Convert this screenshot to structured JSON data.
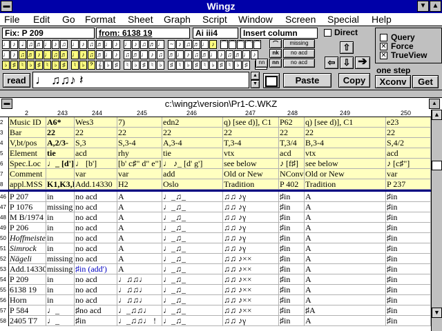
{
  "app": {
    "title": "Wingz"
  },
  "menu": [
    "File",
    "Edit",
    "Go",
    "Format",
    "Sheet",
    "Graph",
    "Script",
    "Window",
    "Screen",
    "Special",
    "Help"
  ],
  "toolbar": {
    "fix_field": "Fix: P 209",
    "from_field": "from: 6138 19",
    "ai_field": "Ai  iii4",
    "insert_field": "Insert column",
    "read_button": "read",
    "paste_button": "Paste",
    "copy_button": "Copy",
    "get_button": "Get",
    "xconv_button": "Xconv",
    "direct_label": "Direct",
    "query_label": "Query",
    "force_label": "Force",
    "trueview_label": "TrueView",
    "one_step_label": "one step",
    "small_buttons": [
      "missing",
      "no acd",
      "nn",
      "no acd"
    ],
    "music_sample": "♩ ♫♫♪ 𝄽"
  },
  "document": {
    "path": "c:\\wingz\\version\\Pr1-C.WKZ",
    "columns": [
      "243",
      "244",
      "245",
      "246",
      "247",
      "248",
      "249",
      "250"
    ],
    "header_rows": [
      {
        "num": "2",
        "label": "Music ID",
        "cells": [
          "A6*",
          "Wes3",
          "7)",
          "edn2",
          "q) [see d)], C1",
          "P62",
          "q) [see d)], C1",
          "e23"
        ]
      },
      {
        "num": "3",
        "label": "Bar",
        "cells": [
          "22",
          "22",
          "22",
          "22",
          "22",
          "22",
          "22",
          "22"
        ]
      },
      {
        "num": "4",
        "label": "V,bt/pos",
        "cells": [
          "A,2/3-",
          "S,3",
          "S,3-4",
          "A,3-4",
          "T,3-4",
          "T,3/4",
          "B,3-4",
          "S,4/2"
        ]
      },
      {
        "num": "5",
        "label": "Element",
        "cells": [
          "tie",
          "acd",
          "rhy",
          "tie",
          "vtx",
          "acd",
          "vtx",
          "acd"
        ]
      },
      {
        "num": "6",
        "label": "Spec.Loc",
        "cells": [
          "♩_ [d']",
          "♩ [b']",
          "[b' c♯\" d\" e\"]",
          "♩ ♪_ [d' g']",
          "see below",
          "♪ [f♯]",
          "see below",
          "♪ [c♯\"]"
        ]
      },
      {
        "num": "7",
        "label": "Comment",
        "cells": [
          "",
          "var",
          "var",
          "add",
          "Old or New",
          "NConv",
          "Old or New",
          "var"
        ]
      },
      {
        "num": "8",
        "label": "appl.MSS",
        "cells": [
          "K1,K3,K",
          "Add.14330",
          "H2",
          "Oslo",
          "Tradition",
          "P 402",
          "Tradition",
          "P 237"
        ]
      }
    ],
    "data_rows": [
      {
        "num": "46",
        "label": "P 207",
        "cells": [
          "in",
          "no acd",
          "A",
          "♩_♫_",
          "♫♫ ♪γ",
          "♯in",
          "A",
          "♯in"
        ]
      },
      {
        "num": "47",
        "label": "P 1076",
        "cells": [
          "missing",
          "no acd",
          "A",
          "♩_♫_",
          "♫♫ ♪γ",
          "♯in",
          "A",
          "♯in"
        ]
      },
      {
        "num": "48",
        "label": "M B/1974",
        "cells": [
          "in",
          "no acd",
          "A",
          "♩_♫_",
          "♫♫ ♪γ",
          "♯in",
          "A",
          "♯in"
        ]
      },
      {
        "num": "49",
        "label": "P 206",
        "cells": [
          "in",
          "no acd",
          "A",
          "♩_♫_",
          "♫♫ ♪γ",
          "♯in",
          "A",
          "♯in"
        ]
      },
      {
        "num": "50",
        "label": "Hoffmeister",
        "cells": [
          "in",
          "no acd",
          "A",
          "♩_♫_",
          "♫♫ ♪γ",
          "♯in",
          "A",
          "♯in"
        ]
      },
      {
        "num": "51",
        "label": "Simrock",
        "cells": [
          "in",
          "no acd",
          "A",
          "♩_♫_",
          "♫♫ ♪γ",
          "♯in",
          "A",
          "♯in"
        ]
      },
      {
        "num": "52",
        "label": "Nägeli",
        "cells": [
          "missing",
          "no acd",
          "A",
          "♩_♫_",
          "♫♫ ♪××",
          "♯in",
          "A",
          "♯in"
        ]
      },
      {
        "num": "53",
        "label": "Add.14330",
        "cells": [
          "missing",
          "♯in (add')",
          "A",
          "♩_♫_",
          "♫♫ ♪××",
          "♯in",
          "A",
          "♯in"
        ]
      },
      {
        "num": "54",
        "label": "P 209",
        "cells": [
          "in",
          "no acd",
          "♩♫♫♩",
          "♩_♫_",
          "♫♫ ♪××",
          "♯in",
          "A",
          "♯in"
        ]
      },
      {
        "num": "55",
        "label": "6138 19",
        "cells": [
          "in",
          "no acd",
          "♩♫♫♩",
          "♩_♫_",
          "♫♫ ♪××",
          "♯in",
          "A",
          "♯in"
        ]
      },
      {
        "num": "56",
        "label": "Horn",
        "cells": [
          "in",
          "no acd",
          "♩♫♫♩",
          "♩_♫_",
          "♫♫ ♪××",
          "♯in",
          "A",
          "♯in"
        ]
      },
      {
        "num": "57",
        "label": "P 584",
        "cells": [
          "♩_",
          "♯no acd",
          "♩_♫♫♩",
          "♩_♫_",
          "♫♫ ♪××",
          "♯in",
          "♯A",
          "♯in"
        ]
      },
      {
        "num": "58",
        "label": "2405 T7",
        "cells": [
          "♩_",
          "♯in",
          "♩_♫♫♩ !",
          "♩_♫_",
          "♫♫ ♪γ",
          "♯in",
          "A",
          "♯in"
        ]
      }
    ]
  }
}
